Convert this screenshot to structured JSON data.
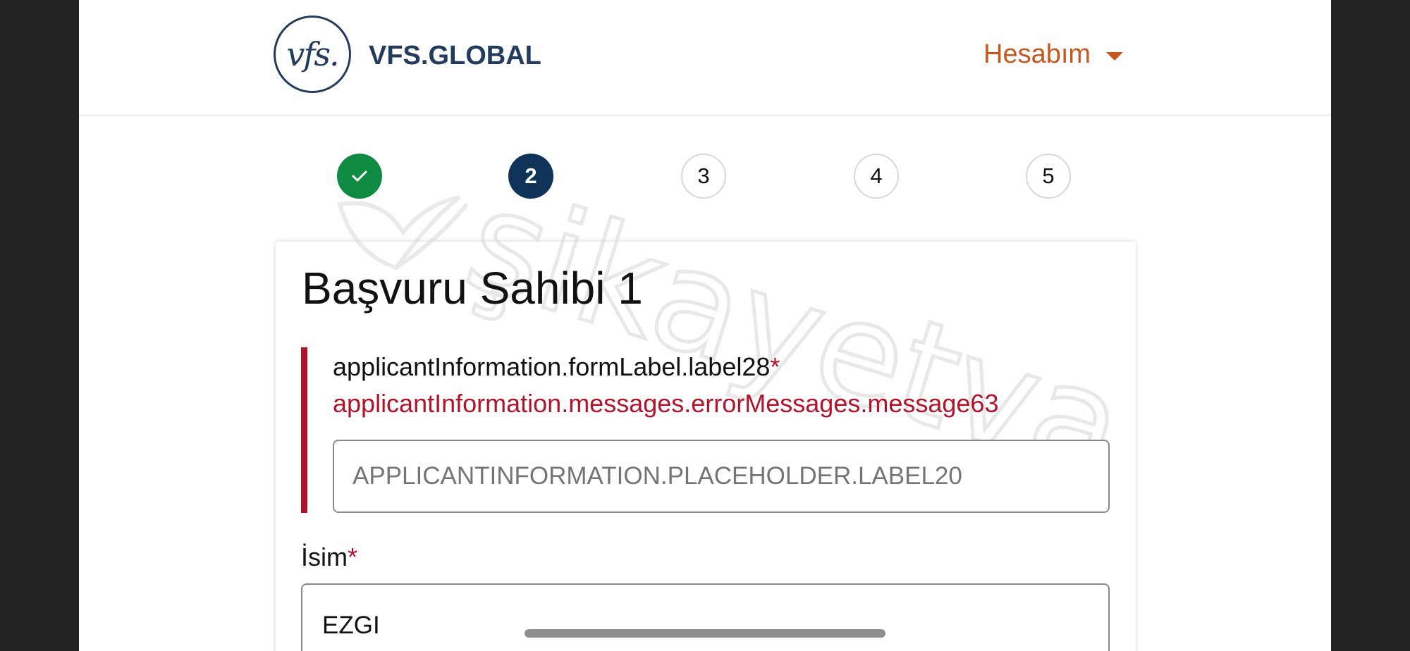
{
  "header": {
    "logo_mark": "vfs.",
    "logo_text": "VFS.GLOBAL",
    "account_label": "Hesabım",
    "account_icon": "caret-down-icon"
  },
  "stepper": {
    "steps": [
      {
        "label": "",
        "state": "completed",
        "icon": "check-icon"
      },
      {
        "label": "2",
        "state": "active"
      },
      {
        "label": "3",
        "state": "upcoming"
      },
      {
        "label": "4",
        "state": "upcoming"
      },
      {
        "label": "5",
        "state": "upcoming"
      }
    ]
  },
  "form": {
    "title": "Başvuru Sahibi 1",
    "field1": {
      "label": "applicantInformation.formLabel.label28",
      "required_mark": "*",
      "error": "applicantInformation.messages.errorMessages.message63",
      "placeholder": "APPLICANTINFORMATION.PLACEHOLDER.LABEL20",
      "value": ""
    },
    "field2": {
      "label": "İsim",
      "required_mark": "*",
      "value": "EZGI"
    }
  },
  "watermark": "şikayetvar",
  "colors": {
    "brand_navy": "#233b5c",
    "account_orange": "#c8571e",
    "step_done_green": "#0f8a43",
    "step_active_navy": "#0f3359",
    "error_red": "#b0132a"
  }
}
